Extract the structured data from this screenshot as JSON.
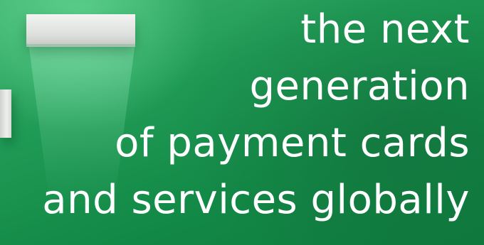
{
  "hero": {
    "headline_lines": [
      "the next",
      "generation",
      "of payment cards",
      "and services globally"
    ],
    "colors": {
      "background": "#1f9a55",
      "text": "#ffffff",
      "shelf": "#e6e8e6"
    }
  }
}
